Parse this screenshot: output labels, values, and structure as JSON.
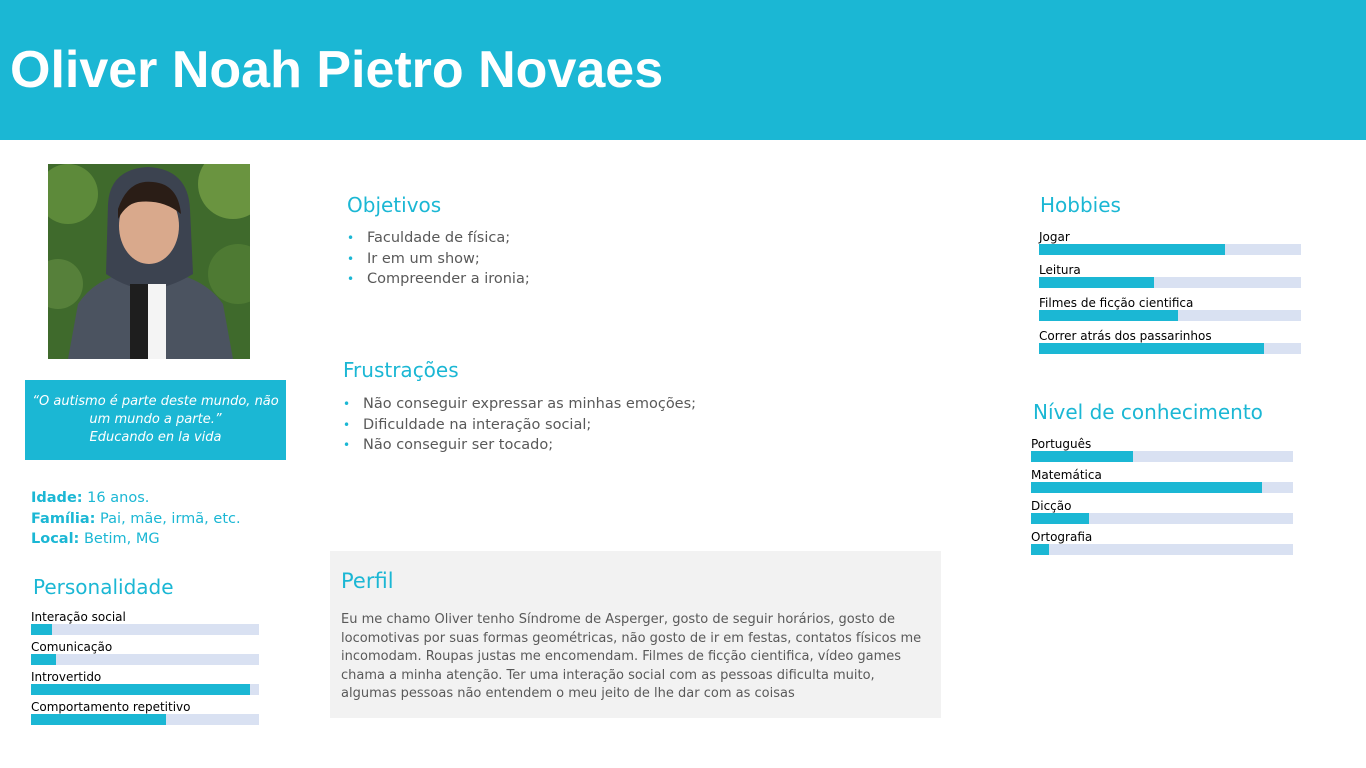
{
  "header": {
    "name": "Oliver Noah Pietro Novaes"
  },
  "quote": {
    "line1": "“O autismo é parte deste mundo, não",
    "line2": "um mundo a parte.”",
    "line3": "Educando en la vida"
  },
  "facts": {
    "age_label": "Idade:",
    "age_value": " 16 anos.",
    "family_label": "Família:",
    "family_value": " Pai, mãe, irmã, etc.",
    "location_label": "Local:",
    "location_value": " Betim, MG"
  },
  "personalidade": {
    "title": "Personalidade",
    "items": [
      {
        "label": "Interação social",
        "level": 0.09
      },
      {
        "label": "Comunicação",
        "level": 0.11
      },
      {
        "label": "Introvertido",
        "level": 0.96
      },
      {
        "label": "Comportamento repetitivo",
        "level": 0.59
      }
    ]
  },
  "objetivos": {
    "title": "Objetivos",
    "items": [
      "Faculdade de física;",
      "Ir em um show;",
      "Compreender a ironia;"
    ]
  },
  "frustracoes": {
    "title": "Frustrações",
    "items": [
      "Não conseguir expressar as minhas emoções;",
      "Dificuldade na interação social;",
      "Não conseguir ser tocado;"
    ]
  },
  "perfil": {
    "title": "Perfil",
    "text": "Eu me chamo Oliver tenho Síndrome de Asperger, gosto de seguir horários, gosto de locomotivas por suas formas geométricas, não gosto de ir em festas, contatos físicos me incomodam. Roupas justas me encomendam. Filmes de ficção cientifica, vídeo games chama a minha atenção. Ter uma interação social com as pessoas dificulta muito, algumas pessoas não entendem o meu jeito de lhe dar com as coisas"
  },
  "hobbies": {
    "title": "Hobbies",
    "items": [
      {
        "label": "Jogar",
        "level": 0.71
      },
      {
        "label": "Leitura",
        "level": 0.44
      },
      {
        "label": "Filmes de ficção cientifica",
        "level": 0.53
      },
      {
        "label": "Correr atrás dos passarinhos",
        "level": 0.86
      }
    ]
  },
  "conhecimento": {
    "title": "Nível de conhecimento",
    "items": [
      {
        "label": "Português",
        "level": 0.39
      },
      {
        "label": "Matemática",
        "level": 0.88
      },
      {
        "label": "Dicção",
        "level": 0.22
      },
      {
        "label": "Ortografia",
        "level": 0.07
      }
    ]
  },
  "colors": {
    "accent": "#1bb7d4",
    "track": "#d9e1f2",
    "panel": "#f2f2f2"
  }
}
